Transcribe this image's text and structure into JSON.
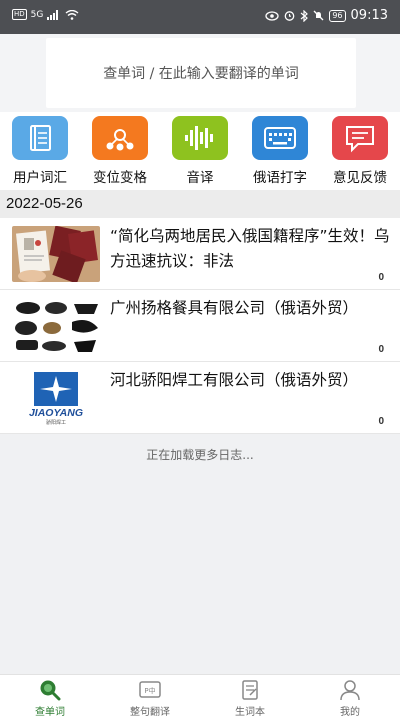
{
  "status_bar": {
    "network": "HD",
    "signal": "5G",
    "battery": "96",
    "time": "09:13"
  },
  "search": {
    "placeholder": "查单词 / 在此输入要翻译的单词"
  },
  "tools": [
    {
      "label": "用户词汇",
      "icon": "vocabulary-book-icon",
      "color": "#5aa9e6"
    },
    {
      "label": "变位变格",
      "icon": "network-nodes-icon",
      "color": "#f4791f"
    },
    {
      "label": "音译",
      "icon": "sound-wave-icon",
      "color": "#8ec21f"
    },
    {
      "label": "俄语打字",
      "icon": "keyboard-icon",
      "color": "#2f86d6"
    },
    {
      "label": "意见反馈",
      "icon": "chat-bubble-icon",
      "color": "#e5474b"
    }
  ],
  "feed": {
    "date": "2022-05-26",
    "items": [
      {
        "title": "“简化乌两地居民入俄国籍程序”生效！乌方迅速抗议：非法",
        "count": "0"
      },
      {
        "title": "广州扬格餐具有限公司（俄语外贸）",
        "count": "0"
      },
      {
        "title": "河北骄阳焊工有限公司（俄语外贸）",
        "count": "0",
        "logo_text": "JIAOYANG",
        "logo_sub": "骄阳焊工"
      }
    ],
    "loading_text": "正在加载更多日志..."
  },
  "tabbar": {
    "tabs": [
      {
        "label": "查单词",
        "icon": "search-icon"
      },
      {
        "label": "整句翻译",
        "icon": "translate-icon"
      },
      {
        "label": "生词本",
        "icon": "notebook-icon"
      },
      {
        "label": "我的",
        "icon": "user-icon"
      }
    ],
    "active_color": "#2e7d32"
  }
}
